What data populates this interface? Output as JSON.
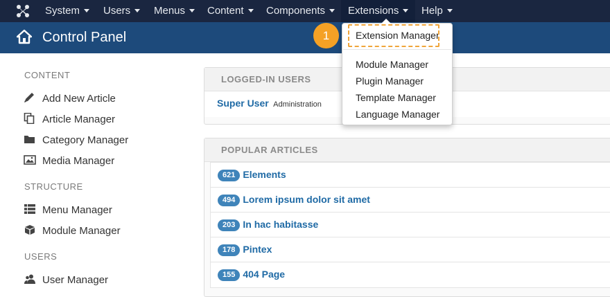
{
  "navbar": {
    "items": [
      {
        "label": "System"
      },
      {
        "label": "Users"
      },
      {
        "label": "Menus"
      },
      {
        "label": "Content"
      },
      {
        "label": "Components"
      },
      {
        "label": "Extensions"
      },
      {
        "label": "Help"
      }
    ]
  },
  "titlebar": {
    "title": "Control Panel"
  },
  "sidebar": {
    "sections": [
      {
        "heading": "CONTENT",
        "items": [
          {
            "label": "Add New Article",
            "icon": "pencil-icon"
          },
          {
            "label": "Article Manager",
            "icon": "copy-icon"
          },
          {
            "label": "Category Manager",
            "icon": "folder-icon"
          },
          {
            "label": "Media Manager",
            "icon": "image-icon"
          }
        ]
      },
      {
        "heading": "STRUCTURE",
        "items": [
          {
            "label": "Menu Manager",
            "icon": "list-icon"
          },
          {
            "label": "Module Manager",
            "icon": "cube-icon"
          }
        ]
      },
      {
        "heading": "USERS",
        "items": [
          {
            "label": "User Manager",
            "icon": "users-icon"
          }
        ]
      }
    ]
  },
  "logged_in": {
    "heading": "LOGGED-IN USERS",
    "users": [
      {
        "name": "Super User",
        "role": "Administration"
      }
    ]
  },
  "popular": {
    "heading": "POPULAR ARTICLES",
    "articles": [
      {
        "hits": "621",
        "title": "Elements"
      },
      {
        "hits": "494",
        "title": "Lorem ipsum dolor sit amet"
      },
      {
        "hits": "203",
        "title": "In hac habitasse"
      },
      {
        "hits": "178",
        "title": "Pintex"
      },
      {
        "hits": "155",
        "title": "404 Page"
      }
    ]
  },
  "extensions_menu": {
    "items": [
      {
        "label": "Extension Manager"
      },
      {
        "label": "Module Manager"
      },
      {
        "label": "Plugin Manager"
      },
      {
        "label": "Template Manager"
      },
      {
        "label": "Language Manager"
      }
    ]
  },
  "callout": {
    "step": "1"
  },
  "colors": {
    "navbar": "#1a2640",
    "titlebar": "#1d4a7b",
    "badge": "#3f84ba",
    "link": "#1f6aa5",
    "callout": "#f5a125"
  }
}
